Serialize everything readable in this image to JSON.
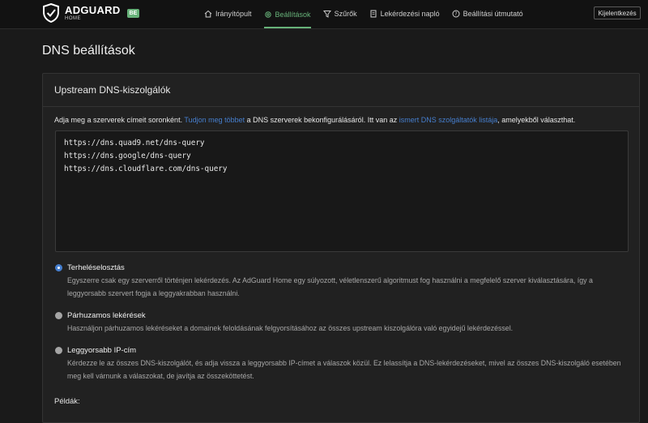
{
  "header": {
    "logo_main": "ADGUARD",
    "logo_sub": "HOME",
    "badge": "BE",
    "nav": [
      {
        "label": "Irányítópult",
        "icon": "home-icon",
        "active": false
      },
      {
        "label": "Beállítások",
        "icon": "settings-icon",
        "active": true
      },
      {
        "label": "Szűrők",
        "icon": "filter-icon",
        "active": false
      },
      {
        "label": "Lekérdezési napló",
        "icon": "log-icon",
        "active": false
      },
      {
        "label": "Beállítási útmutató",
        "icon": "help-icon",
        "active": false
      }
    ],
    "logout": "Kijelentkezés"
  },
  "page": {
    "title": "DNS beállítások"
  },
  "upstream_card": {
    "title": "Upstream DNS-kiszolgálók",
    "desc_before": "Adja meg a szerverek címeit soronként. ",
    "desc_link1": "Tudjon meg többet",
    "desc_middle": " a DNS szerverek bekonfigurálásáról. Itt van az ",
    "desc_link2": "ismert DNS szolgáltatók listája",
    "desc_after": ", amelyekből választhat.",
    "upstreams": "https://dns.quad9.net/dns-query\nhttps://dns.google/dns-query\nhttps://dns.cloudflare.com/dns-query",
    "options": [
      {
        "label": "Terheléselosztás",
        "checked": true,
        "desc": "Egyszerre csak egy szerverről történjen lekérdezés. Az AdGuard Home egy súlyozott, véletlenszerű algoritmust fog használni a megfelelő szerver kiválasztására, így a leggyorsabb szervert fogja a leggyakrabban használni."
      },
      {
        "label": "Párhuzamos lekérések",
        "checked": false,
        "desc": "Használjon párhuzamos lekéréseket a domainek feloldásának felgyorsításához az összes upstream kiszolgálóra való egyidejű lekérdezéssel."
      },
      {
        "label": "Leggyorsabb IP-cím",
        "checked": false,
        "desc": "Kérdezze le az összes DNS-kiszolgálót, és adja vissza a leggyorsabb IP-címet a válaszok közül. Ez lelassítja a DNS-lekérdezéseket, mivel az összes DNS-kiszolgáló esetében meg kell várnunk a válaszokat, de javítja az összeköttetést."
      }
    ],
    "examples_label": "Példák:"
  },
  "colors": {
    "accent_green": "#67b279",
    "link_blue": "#467fcf",
    "background": "#1a1a1a"
  }
}
